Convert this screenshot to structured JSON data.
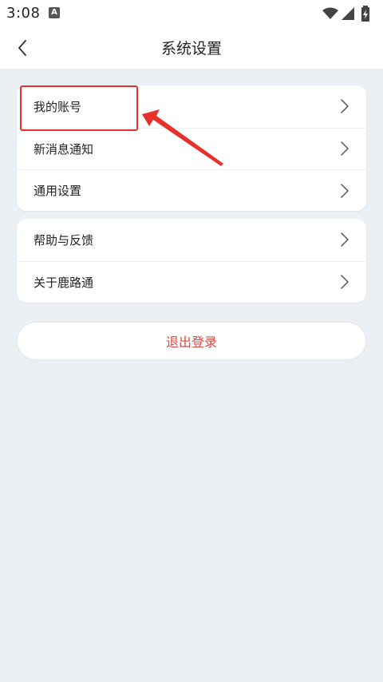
{
  "status_bar": {
    "time": "3:08",
    "notification_icon": "a-icon",
    "icons": [
      "wifi-icon",
      "signal-icon",
      "battery-charging-icon"
    ]
  },
  "header": {
    "title": "系统设置",
    "back_icon": "chevron-left-icon"
  },
  "settings_group_1": [
    {
      "label": "我的账号"
    },
    {
      "label": "新消息通知"
    },
    {
      "label": "通用设置"
    }
  ],
  "settings_group_2": [
    {
      "label": "帮助与反馈"
    },
    {
      "label": "关于鹿路通"
    }
  ],
  "logout": {
    "label": "退出登录"
  },
  "colors": {
    "background": "#ebf0f4",
    "card": "#ffffff",
    "logout_text": "#e2453c",
    "annotation": "#e8312b"
  }
}
